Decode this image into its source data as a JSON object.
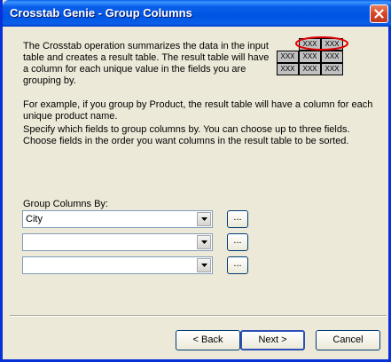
{
  "window": {
    "title": "Crosstab Genie - Group Columns"
  },
  "description": {
    "p1": "The Crosstab operation summarizes the data in the input table and creates a result table. The result table will have a column for each unique value in the fields you are grouping by.",
    "p2": "For example, if you group by Product, the result table will have a column for each unique product name.",
    "p3": "Specify which fields to group columns by. You can choose up to three fields. Choose fields in the order you want columns in the result table to be sorted."
  },
  "illustration": {
    "cells": [
      "XXX",
      "XXX",
      "XXX",
      "XXX",
      "XXX",
      "XXX",
      "XXX",
      "XXX"
    ],
    "highlight_color": "#e00000"
  },
  "group_columns": {
    "label": "Group Columns By:",
    "fields": [
      {
        "value": "City",
        "button_label": "..."
      },
      {
        "value": "",
        "button_label": "..."
      },
      {
        "value": "",
        "button_label": "..."
      }
    ]
  },
  "buttons": {
    "back": "< Back",
    "next": "Next >",
    "cancel": "Cancel"
  },
  "colors": {
    "titlebar": "#0054e3",
    "dialog_bg": "#ece9d8",
    "close_button": "#d4462a"
  }
}
